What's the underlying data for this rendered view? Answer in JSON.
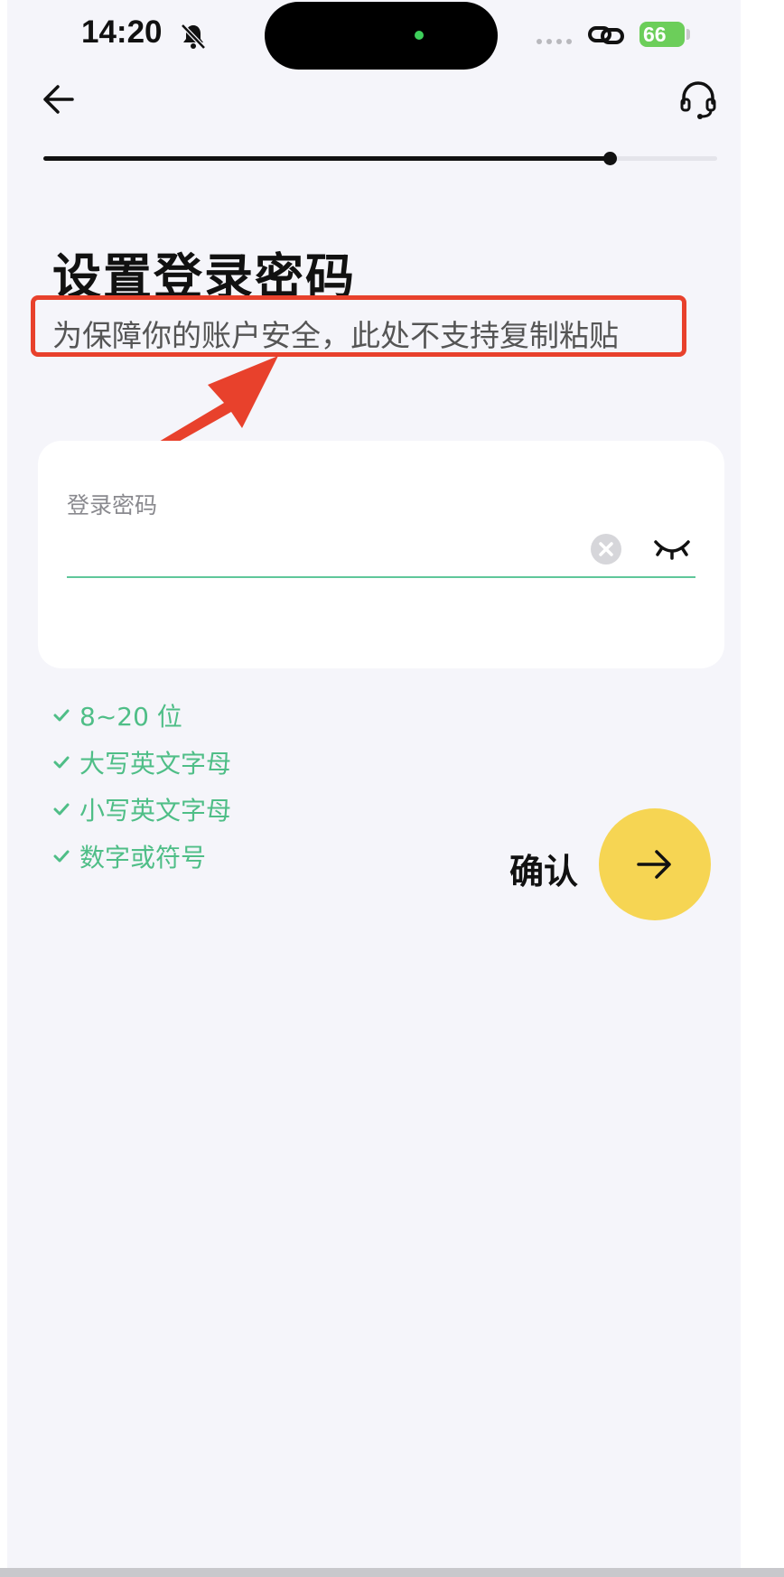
{
  "status_bar": {
    "time": "14:20",
    "battery": "66"
  },
  "page": {
    "title": "设置登录密码",
    "subtitle": "为保障你的账户安全，此处不支持复制粘贴",
    "progress": 0.84
  },
  "form": {
    "password_label": "登录密码",
    "password_value": "",
    "password_placeholder": ""
  },
  "rules": [
    {
      "text": "8~20 位",
      "met": true
    },
    {
      "text": "大写英文字母",
      "met": true
    },
    {
      "text": "小写英文字母",
      "met": true
    },
    {
      "text": "数字或符号",
      "met": true
    }
  ],
  "actions": {
    "confirm_label": "确认"
  },
  "colors": {
    "accent_yellow": "#f6d553",
    "rule_green": "#4fbe87",
    "annotation_red": "#e8412c",
    "background": "#f5f5fa"
  },
  "icons": [
    "bell-slash-icon",
    "link-icon",
    "back-arrow-icon",
    "headset-icon",
    "clear-icon",
    "eye-closed-icon",
    "check-icon",
    "arrow-right-icon"
  ]
}
